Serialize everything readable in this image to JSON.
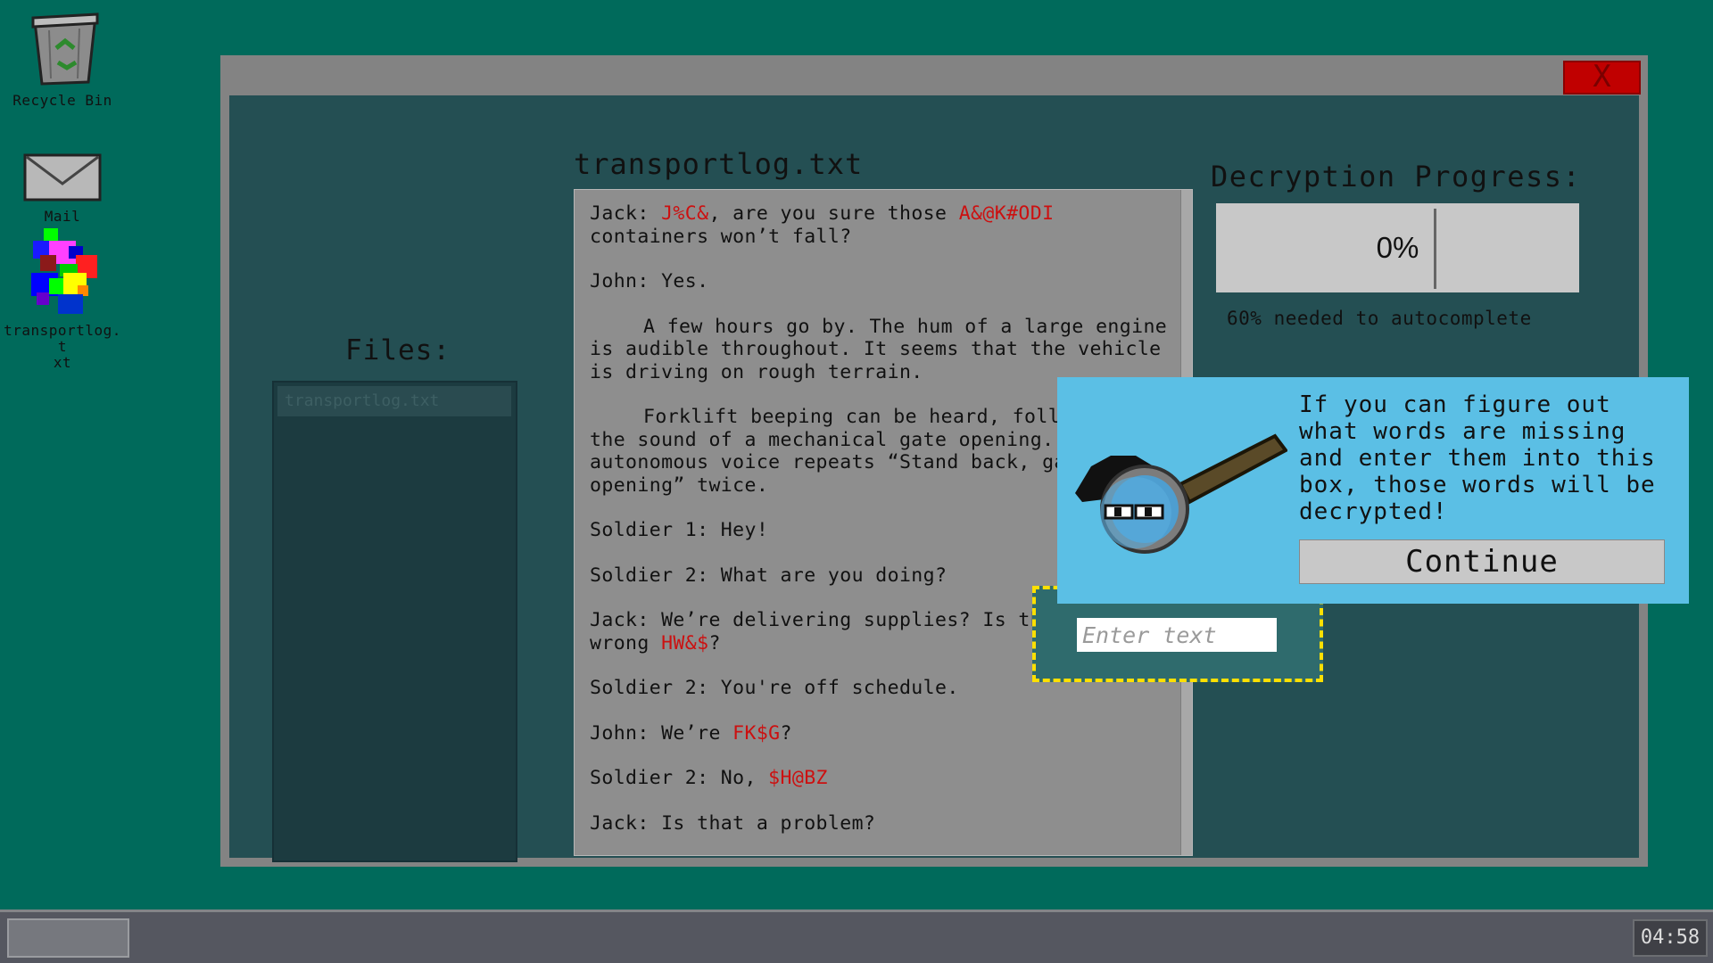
{
  "desktop": {
    "icons": [
      {
        "label": "Recycle Bin",
        "icon": "recycle-bin-icon"
      },
      {
        "label": "Mail",
        "icon": "mail-icon"
      },
      {
        "label": "transportlog.t\nxt",
        "icon": "corrupted-file-icon"
      }
    ]
  },
  "window": {
    "close_label": "X",
    "files_title": "Files:",
    "files": [
      "transportlog.txt"
    ],
    "doc_title": "transportlog.txt",
    "doc_lines": {
      "l1a": "Jack: ",
      "l1b": "J%C&",
      "l1c": ", are you sure those ",
      "l1d": "A&@K#ODI",
      "l1e": " containers won’t fall?",
      "l2": "John: Yes.",
      "l3": "A few hours go by. The hum of a large engine is audible throughout. It seems that the vehicle is driving on rough terrain.",
      "l4": "Forklift beeping can be heard, followed by the sound of a mechanical gate opening. An autonomous voice repeats “Stand back, gate opening” twice.",
      "l5": "Soldier 1: Hey!",
      "l6": "Soldier 2: What are you doing?",
      "l7a": "Jack: We’re delivering supplies? Is this the wrong ",
      "l7b": "HW&$",
      "l7c": "?",
      "l8": "Soldier 2: You're off schedule.",
      "l9a": "John: We’re ",
      "l9b": "FK$G",
      "l9c": "?",
      "l10a": "Soldier 2: No, ",
      "l10b": "$H@BZ",
      "l11": "Jack: Is that a problem?"
    },
    "progress_title": "Decryption Progress:",
    "progress_value": "0%",
    "progress_fraction": 0,
    "progress_note": "60% needed to autocomplete",
    "input_placeholder": "Enter text"
  },
  "tip": {
    "text": "If you can figure out what words are missing and enter them into this box, those words will be decrypted!",
    "button": "Continue",
    "icon": "detective-magnifier-icon"
  },
  "taskbar": {
    "clock": "04:58"
  },
  "colors": {
    "desktop": "#006a5b",
    "encrypted_text": "#cc1010",
    "highlight_border": "#ffe000",
    "tip_bg": "#5bbfe5"
  }
}
